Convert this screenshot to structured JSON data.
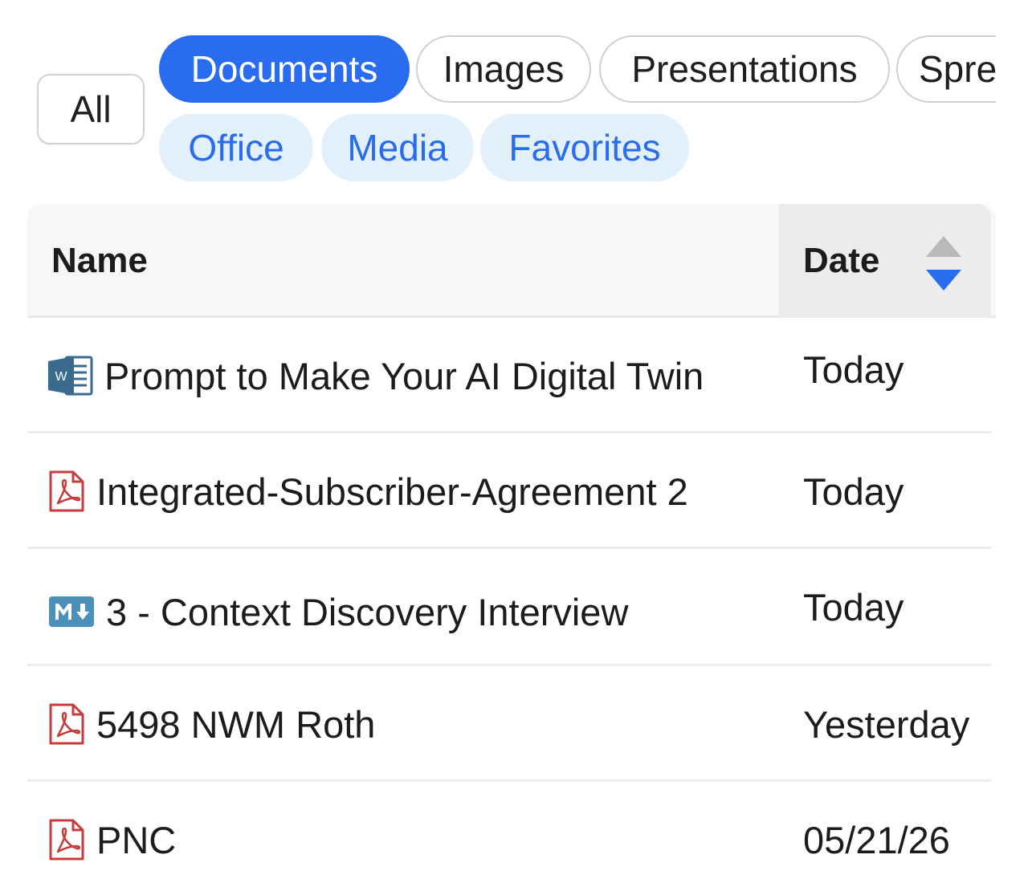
{
  "filters": {
    "all": "All",
    "primary": [
      {
        "label": "Documents",
        "active": true
      },
      {
        "label": "Images",
        "active": false
      },
      {
        "label": "Presentations",
        "active": false
      },
      {
        "label": "Spreadsheets",
        "active": false
      }
    ],
    "secondary": [
      {
        "label": "Office"
      },
      {
        "label": "Media"
      },
      {
        "label": "Favorites"
      }
    ]
  },
  "table": {
    "columns": {
      "name": "Name",
      "date": "Date"
    },
    "sort": {
      "column": "date",
      "direction": "descending"
    },
    "rows": [
      {
        "icon": "word-doc-icon",
        "name": "Prompt to Make Your AI Digital Twin",
        "date": "Today"
      },
      {
        "icon": "pdf-icon",
        "name": "Integrated-Subscriber-Agreement 2",
        "date": "Today"
      },
      {
        "icon": "markdown-icon",
        "name": "3 - Context Discovery Interview",
        "date": "Today"
      },
      {
        "icon": "pdf-icon",
        "name": "5498 NWM Roth",
        "date": "Yesterday"
      },
      {
        "icon": "pdf-icon",
        "name": "PNC",
        "date": "05/21/26"
      }
    ]
  },
  "colors": {
    "accent": "#2a6cf0",
    "chip_soft_bg": "#e2f0fc",
    "pdf_red": "#c43c3c",
    "word_blue": "#3a6b8f",
    "markdown_blue": "#4a90b8"
  }
}
